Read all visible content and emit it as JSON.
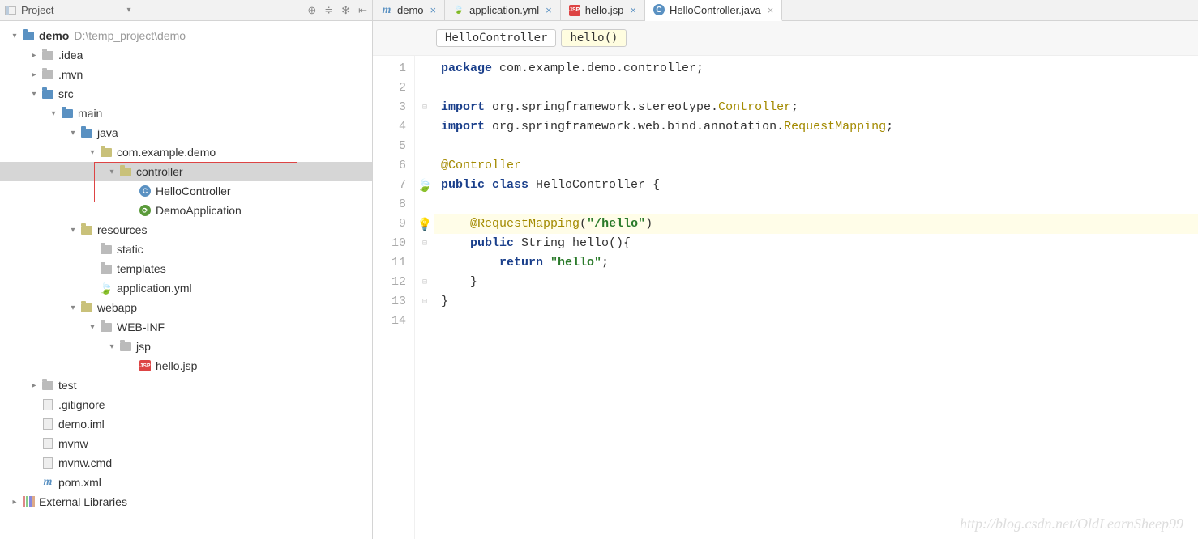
{
  "header": {
    "project_label": "Project",
    "icons": {
      "target": "⊕",
      "collapse": "≑",
      "gear": "✻",
      "hide": "⇤"
    }
  },
  "tabs": [
    {
      "name": "demo",
      "icon": "m",
      "modified": true
    },
    {
      "name": "application.yml",
      "icon": "leaf",
      "modified": true
    },
    {
      "name": "hello.jsp",
      "icon": "jsp",
      "modified": true
    },
    {
      "name": "HelloController.java",
      "icon": "java",
      "active": true,
      "modified": false
    }
  ],
  "tree": [
    {
      "depth": 0,
      "arrow": "down",
      "icon": "folder-blue",
      "label": "demo",
      "path": "D:\\temp_project\\demo",
      "bold": true
    },
    {
      "depth": 1,
      "arrow": "right",
      "icon": "folder-grey",
      "label": ".idea"
    },
    {
      "depth": 1,
      "arrow": "right",
      "icon": "folder-grey",
      "label": ".mvn"
    },
    {
      "depth": 1,
      "arrow": "down",
      "icon": "folder-blue",
      "label": "src"
    },
    {
      "depth": 2,
      "arrow": "down",
      "icon": "folder-blue",
      "label": "main"
    },
    {
      "depth": 3,
      "arrow": "down",
      "icon": "folder-blue",
      "label": "java"
    },
    {
      "depth": 4,
      "arrow": "down",
      "icon": "folder",
      "label": "com.example.demo"
    },
    {
      "depth": 5,
      "arrow": "down",
      "icon": "folder",
      "label": "controller",
      "selected": true,
      "hl_start": true
    },
    {
      "depth": 6,
      "arrow": "none",
      "icon": "class",
      "label": "HelloController"
    },
    {
      "depth": 6,
      "arrow": "none",
      "icon": "spring",
      "label": "DemoApplication"
    },
    {
      "depth": 3,
      "arrow": "down",
      "icon": "folder",
      "label": "resources"
    },
    {
      "depth": 4,
      "arrow": "none",
      "icon": "folder-grey",
      "label": "static"
    },
    {
      "depth": 4,
      "arrow": "none",
      "icon": "folder-grey",
      "label": "templates"
    },
    {
      "depth": 4,
      "arrow": "none",
      "icon": "leaf",
      "label": "application.yml"
    },
    {
      "depth": 3,
      "arrow": "down",
      "icon": "folder",
      "label": "webapp"
    },
    {
      "depth": 4,
      "arrow": "down",
      "icon": "folder-grey",
      "label": "WEB-INF"
    },
    {
      "depth": 5,
      "arrow": "down",
      "icon": "folder-grey",
      "label": "jsp"
    },
    {
      "depth": 6,
      "arrow": "none",
      "icon": "jsp",
      "label": "hello.jsp"
    },
    {
      "depth": 1,
      "arrow": "right",
      "icon": "folder-grey",
      "label": "test"
    },
    {
      "depth": 1,
      "arrow": "none",
      "icon": "file",
      "label": ".gitignore"
    },
    {
      "depth": 1,
      "arrow": "none",
      "icon": "file",
      "label": "demo.iml"
    },
    {
      "depth": 1,
      "arrow": "none",
      "icon": "file",
      "label": "mvnw"
    },
    {
      "depth": 1,
      "arrow": "none",
      "icon": "file",
      "label": "mvnw.cmd"
    },
    {
      "depth": 1,
      "arrow": "none",
      "icon": "m",
      "label": "pom.xml"
    },
    {
      "depth": 0,
      "arrow": "right",
      "icon": "lib",
      "label": "External Libraries"
    }
  ],
  "breadcrumb": {
    "class": "HelloController",
    "method": "hello()"
  },
  "code": {
    "lines": [
      {
        "n": 1,
        "tokens": [
          [
            "kw",
            "package"
          ],
          [
            "plain",
            " com.example.demo.controller;"
          ]
        ]
      },
      {
        "n": 2,
        "tokens": []
      },
      {
        "n": 3,
        "tokens": [
          [
            "kw",
            "import"
          ],
          [
            "plain",
            " org.springframework.stereotype."
          ],
          [
            "cls",
            "Controller"
          ],
          [
            "plain",
            ";"
          ]
        ],
        "fold": "open"
      },
      {
        "n": 4,
        "tokens": [
          [
            "kw",
            "import"
          ],
          [
            "plain",
            " org.springframework.web.bind.annotation."
          ],
          [
            "cls",
            "RequestMapping"
          ],
          [
            "plain",
            ";"
          ]
        ]
      },
      {
        "n": 5,
        "tokens": []
      },
      {
        "n": 6,
        "tokens": [
          [
            "ann",
            "@Controller"
          ]
        ]
      },
      {
        "n": 7,
        "tokens": [
          [
            "kw",
            "public class"
          ],
          [
            "plain",
            " HelloController {"
          ]
        ],
        "mark": "spring",
        "fold": "open"
      },
      {
        "n": 8,
        "tokens": []
      },
      {
        "n": 9,
        "hl": true,
        "tokens": [
          [
            "plain",
            "    "
          ],
          [
            "ann",
            "@RequestMapping"
          ],
          [
            "plain",
            "("
          ],
          [
            "str",
            "\"/hello\""
          ],
          [
            "plain",
            ")"
          ]
        ],
        "mark": "bulb"
      },
      {
        "n": 10,
        "tokens": [
          [
            "plain",
            "    "
          ],
          [
            "kw",
            "public"
          ],
          [
            "plain",
            " String hello(){"
          ]
        ],
        "fold": "open"
      },
      {
        "n": 11,
        "tokens": [
          [
            "plain",
            "        "
          ],
          [
            "kw",
            "return "
          ],
          [
            "str",
            "\"hello\""
          ],
          [
            "plain",
            ";"
          ]
        ]
      },
      {
        "n": 12,
        "tokens": [
          [
            "plain",
            "    }"
          ]
        ],
        "fold": "close"
      },
      {
        "n": 13,
        "tokens": [
          [
            "plain",
            "}"
          ]
        ],
        "fold": "close"
      },
      {
        "n": 14,
        "tokens": []
      }
    ]
  },
  "watermark": "http://blog.csdn.net/OldLearnSheep99"
}
